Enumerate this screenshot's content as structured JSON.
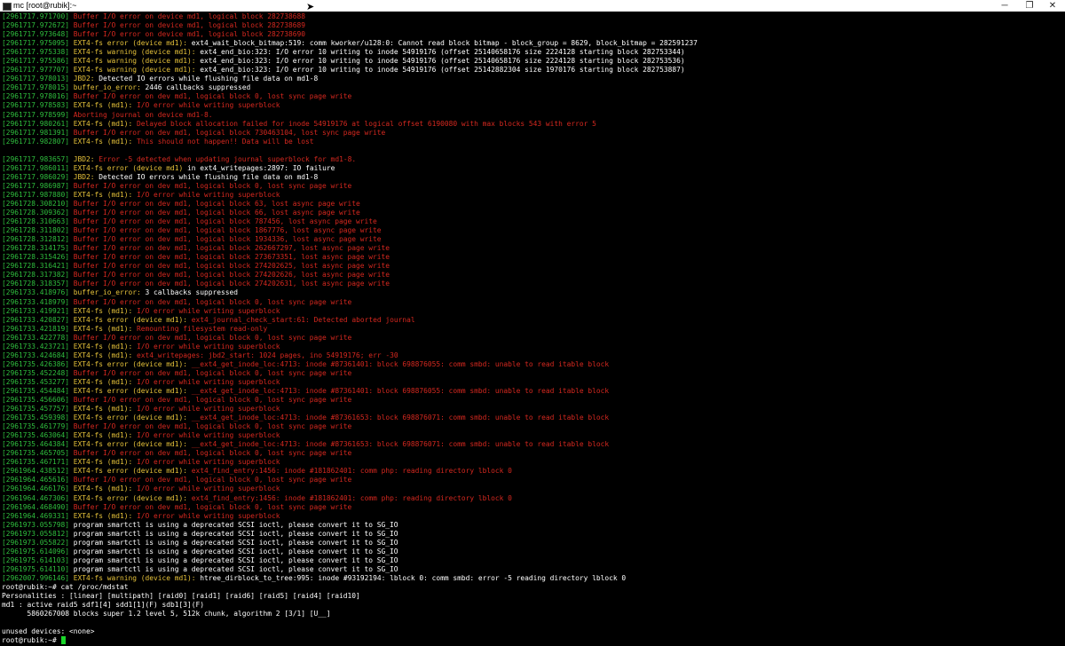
{
  "window": {
    "title": "mc [root@rubik]:~",
    "minimize_glyph": "─",
    "restore_glyph": "❐",
    "close_glyph": "✕"
  },
  "terminal": {
    "lines": [
      {
        "ts": "[2961717.971700]",
        "segs": [
          {
            "c": "red",
            "t": " Buffer I/O error on device md1, logical block 282738688"
          }
        ]
      },
      {
        "ts": "[2961717.972672]",
        "segs": [
          {
            "c": "red",
            "t": " Buffer I/O error on device md1, logical block 282738689"
          }
        ]
      },
      {
        "ts": "[2961717.973648]",
        "segs": [
          {
            "c": "red",
            "t": " Buffer I/O error on device md1, logical block 282738690"
          }
        ]
      },
      {
        "ts": "[2961717.975095]",
        "segs": [
          {
            "c": "yellow",
            "t": " EXT4-fs error (device md1): "
          },
          {
            "c": "white",
            "t": "ext4_wait_block_bitmap:519: comm kworker/u128:0: Cannot read block bitmap - block_group = 8629, block_bitmap = 282591237"
          }
        ]
      },
      {
        "ts": "[2961717.975338]",
        "segs": [
          {
            "c": "yellow",
            "t": " EXT4-fs warning (device md1): "
          },
          {
            "c": "white",
            "t": "ext4_end_bio:323: I/O error 10 writing to inode 54919176 (offset 25140658176 size 2224128 starting block 282753344)"
          }
        ]
      },
      {
        "ts": "[2961717.975586]",
        "segs": [
          {
            "c": "yellow",
            "t": " EXT4-fs warning (device md1): "
          },
          {
            "c": "white",
            "t": "ext4_end_bio:323: I/O error 10 writing to inode 54919176 (offset 25140658176 size 2224128 starting block 282753536)"
          }
        ]
      },
      {
        "ts": "[2961717.977707]",
        "segs": [
          {
            "c": "yellow",
            "t": " EXT4-fs warning (device md1): "
          },
          {
            "c": "white",
            "t": "ext4_end_bio:323: I/O error 10 writing to inode 54919176 (offset 25142882304 size 1970176 starting block 282753887)"
          }
        ]
      },
      {
        "ts": "[2961717.978013]",
        "segs": [
          {
            "c": "yellow",
            "t": " JBD2: "
          },
          {
            "c": "white",
            "t": "Detected IO errors while flushing file data on md1-8"
          }
        ]
      },
      {
        "ts": "[2961717.978015]",
        "segs": [
          {
            "c": "yellow",
            "t": " buffer_io_error: "
          },
          {
            "c": "white",
            "t": "2446 callbacks suppressed"
          }
        ]
      },
      {
        "ts": "[2961717.978016]",
        "segs": [
          {
            "c": "red",
            "t": " Buffer I/O error on dev md1, logical block 0, lost sync page write"
          }
        ]
      },
      {
        "ts": "[2961717.978583]",
        "segs": [
          {
            "c": "yellow",
            "t": " EXT4-fs (md1): "
          },
          {
            "c": "red",
            "t": "I/O error while writing superblock"
          }
        ]
      },
      {
        "ts": "[2961717.978599]",
        "segs": [
          {
            "c": "red",
            "t": " Aborting journal on device md1-8."
          }
        ]
      },
      {
        "ts": "[2961717.980261]",
        "segs": [
          {
            "c": "yellow",
            "t": " EXT4-fs (md1): "
          },
          {
            "c": "red",
            "t": "Delayed block allocation failed for inode 54919176 at logical offset 6190080 with max blocks 543 with error 5"
          }
        ]
      },
      {
        "ts": "[2961717.981391]",
        "segs": [
          {
            "c": "red",
            "t": " Buffer I/O error on dev md1, logical block 730463104, lost sync page write"
          }
        ]
      },
      {
        "ts": "[2961717.982807]",
        "segs": [
          {
            "c": "yellow",
            "t": " EXT4-fs (md1): "
          },
          {
            "c": "red",
            "t": "This should not happen!! Data will be lost"
          }
        ]
      },
      {
        "ts": "",
        "segs": []
      },
      {
        "ts": "[2961717.983657]",
        "segs": [
          {
            "c": "yellow",
            "t": " JBD2: "
          },
          {
            "c": "red",
            "t": "Error -5 detected when updating journal superblock for md1-8."
          }
        ]
      },
      {
        "ts": "[2961717.986011]",
        "segs": [
          {
            "c": "yellow",
            "t": " EXT4-fs error (device md1) "
          },
          {
            "c": "white",
            "t": "in ext4_writepages:2897: IO failure"
          }
        ]
      },
      {
        "ts": "[2961717.986029]",
        "segs": [
          {
            "c": "yellow",
            "t": " JBD2: "
          },
          {
            "c": "white",
            "t": "Detected IO errors while flushing file data on md1-8"
          }
        ]
      },
      {
        "ts": "[2961717.986987]",
        "segs": [
          {
            "c": "red",
            "t": " Buffer I/O error on dev md1, logical block 0, lost sync page write"
          }
        ]
      },
      {
        "ts": "[2961717.987880]",
        "segs": [
          {
            "c": "yellow",
            "t": " EXT4-fs (md1): "
          },
          {
            "c": "red",
            "t": "I/O error while writing superblock"
          }
        ]
      },
      {
        "ts": "[2961728.308210]",
        "segs": [
          {
            "c": "red",
            "t": " Buffer I/O error on dev md1, logical block 63, lost async page write"
          }
        ]
      },
      {
        "ts": "[2961728.309362]",
        "segs": [
          {
            "c": "red",
            "t": " Buffer I/O error on dev md1, logical block 66, lost async page write"
          }
        ]
      },
      {
        "ts": "[2961728.310663]",
        "segs": [
          {
            "c": "red",
            "t": " Buffer I/O error on dev md1, logical block 787456, lost async page write"
          }
        ]
      },
      {
        "ts": "[2961728.311802]",
        "segs": [
          {
            "c": "red",
            "t": " Buffer I/O error on dev md1, logical block 1867776, lost async page write"
          }
        ]
      },
      {
        "ts": "[2961728.312812]",
        "segs": [
          {
            "c": "red",
            "t": " Buffer I/O error on dev md1, logical block 1934336, lost async page write"
          }
        ]
      },
      {
        "ts": "[2961728.314175]",
        "segs": [
          {
            "c": "red",
            "t": " Buffer I/O error on dev md1, logical block 262667297, lost async page write"
          }
        ]
      },
      {
        "ts": "[2961728.315426]",
        "segs": [
          {
            "c": "red",
            "t": " Buffer I/O error on dev md1, logical block 273673351, lost async page write"
          }
        ]
      },
      {
        "ts": "[2961728.316421]",
        "segs": [
          {
            "c": "red",
            "t": " Buffer I/O error on dev md1, logical block 274202625, lost async page write"
          }
        ]
      },
      {
        "ts": "[2961728.317382]",
        "segs": [
          {
            "c": "red",
            "t": " Buffer I/O error on dev md1, logical block 274202626, lost async page write"
          }
        ]
      },
      {
        "ts": "[2961728.318357]",
        "segs": [
          {
            "c": "red",
            "t": " Buffer I/O error on dev md1, logical block 274202631, lost async page write"
          }
        ]
      },
      {
        "ts": "[2961733.418976]",
        "segs": [
          {
            "c": "yellow",
            "t": " buffer_io_error: "
          },
          {
            "c": "white",
            "t": "3 callbacks suppressed"
          }
        ]
      },
      {
        "ts": "[2961733.418979]",
        "segs": [
          {
            "c": "red",
            "t": " Buffer I/O error on dev md1, logical block 0, lost sync page write"
          }
        ]
      },
      {
        "ts": "[2961733.419921]",
        "segs": [
          {
            "c": "yellow",
            "t": " EXT4-fs (md1): "
          },
          {
            "c": "red",
            "t": "I/O error while writing superblock"
          }
        ]
      },
      {
        "ts": "[2961733.420827]",
        "segs": [
          {
            "c": "yellow",
            "t": " EXT4-fs error (device md1): "
          },
          {
            "c": "red",
            "t": "ext4_journal_check_start:61: Detected aborted journal"
          }
        ]
      },
      {
        "ts": "[2961733.421819]",
        "segs": [
          {
            "c": "yellow",
            "t": " EXT4-fs (md1): "
          },
          {
            "c": "red",
            "t": "Remounting filesystem read-only"
          }
        ]
      },
      {
        "ts": "[2961733.422778]",
        "segs": [
          {
            "c": "red",
            "t": " Buffer I/O error on dev md1, logical block 0, lost sync page write"
          }
        ]
      },
      {
        "ts": "[2961733.423721]",
        "segs": [
          {
            "c": "yellow",
            "t": " EXT4-fs (md1): "
          },
          {
            "c": "red",
            "t": "I/O error while writing superblock"
          }
        ]
      },
      {
        "ts": "[2961733.424684]",
        "segs": [
          {
            "c": "yellow",
            "t": " EXT4-fs (md1): "
          },
          {
            "c": "red",
            "t": "ext4_writepages: jbd2_start: 1024 pages, ino 54919176; err -30"
          }
        ]
      },
      {
        "ts": "[2961735.426386]",
        "segs": [
          {
            "c": "yellow",
            "t": " EXT4-fs error (device md1): "
          },
          {
            "c": "red",
            "t": "__ext4_get_inode_loc:4713: inode #87361401: block 698876055: comm smbd: unable to read itable block"
          }
        ]
      },
      {
        "ts": "[2961735.452248]",
        "segs": [
          {
            "c": "red",
            "t": " Buffer I/O error on dev md1, logical block 0, lost sync page write"
          }
        ]
      },
      {
        "ts": "[2961735.453277]",
        "segs": [
          {
            "c": "yellow",
            "t": " EXT4-fs (md1): "
          },
          {
            "c": "red",
            "t": "I/O error while writing superblock"
          }
        ]
      },
      {
        "ts": "[2961735.454484]",
        "segs": [
          {
            "c": "yellow",
            "t": " EXT4-fs error (device md1): "
          },
          {
            "c": "red",
            "t": "__ext4_get_inode_loc:4713: inode #87361401: block 698876055: comm smbd: unable to read itable block"
          }
        ]
      },
      {
        "ts": "[2961735.456606]",
        "segs": [
          {
            "c": "red",
            "t": " Buffer I/O error on dev md1, logical block 0, lost sync page write"
          }
        ]
      },
      {
        "ts": "[2961735.457757]",
        "segs": [
          {
            "c": "yellow",
            "t": " EXT4-fs (md1): "
          },
          {
            "c": "red",
            "t": "I/O error while writing superblock"
          }
        ]
      },
      {
        "ts": "[2961735.459398]",
        "segs": [
          {
            "c": "yellow",
            "t": " EXT4-fs error (device md1): "
          },
          {
            "c": "red",
            "t": "__ext4_get_inode_loc:4713: inode #87361653: block 698876071: comm smbd: unable to read itable block"
          }
        ]
      },
      {
        "ts": "[2961735.461779]",
        "segs": [
          {
            "c": "red",
            "t": " Buffer I/O error on dev md1, logical block 0, lost sync page write"
          }
        ]
      },
      {
        "ts": "[2961735.463064]",
        "segs": [
          {
            "c": "yellow",
            "t": " EXT4-fs (md1): "
          },
          {
            "c": "red",
            "t": "I/O error while writing superblock"
          }
        ]
      },
      {
        "ts": "[2961735.464384]",
        "segs": [
          {
            "c": "yellow",
            "t": " EXT4-fs error (device md1): "
          },
          {
            "c": "red",
            "t": "__ext4_get_inode_loc:4713: inode #87361653: block 698876071: comm smbd: unable to read itable block"
          }
        ]
      },
      {
        "ts": "[2961735.465705]",
        "segs": [
          {
            "c": "red",
            "t": " Buffer I/O error on dev md1, logical block 0, lost sync page write"
          }
        ]
      },
      {
        "ts": "[2961735.467171]",
        "segs": [
          {
            "c": "yellow",
            "t": " EXT4-fs (md1): "
          },
          {
            "c": "red",
            "t": "I/O error while writing superblock"
          }
        ]
      },
      {
        "ts": "[2961964.438512]",
        "segs": [
          {
            "c": "yellow",
            "t": " EXT4-fs error (device md1): "
          },
          {
            "c": "red",
            "t": "ext4_find_entry:1456: inode #181862401: comm php: reading directory lblock 0"
          }
        ]
      },
      {
        "ts": "[2961964.465616]",
        "segs": [
          {
            "c": "red",
            "t": " Buffer I/O error on dev md1, logical block 0, lost sync page write"
          }
        ]
      },
      {
        "ts": "[2961964.466176]",
        "segs": [
          {
            "c": "yellow",
            "t": " EXT4-fs (md1): "
          },
          {
            "c": "red",
            "t": "I/O error while writing superblock"
          }
        ]
      },
      {
        "ts": "[2961964.467306]",
        "segs": [
          {
            "c": "yellow",
            "t": " EXT4-fs error (device md1): "
          },
          {
            "c": "red",
            "t": "ext4_find_entry:1456: inode #181862401: comm php: reading directory lblock 0"
          }
        ]
      },
      {
        "ts": "[2961964.468490]",
        "segs": [
          {
            "c": "red",
            "t": " Buffer I/O error on dev md1, logical block 0, lost sync page write"
          }
        ]
      },
      {
        "ts": "[2961964.469331]",
        "segs": [
          {
            "c": "yellow",
            "t": " EXT4-fs (md1): "
          },
          {
            "c": "red",
            "t": "I/O error while writing superblock"
          }
        ]
      },
      {
        "ts": "[2961973.055798]",
        "segs": [
          {
            "c": "white",
            "t": " program smartctl is using a deprecated SCSI ioctl, please convert it to SG_IO"
          }
        ]
      },
      {
        "ts": "[2961973.055812]",
        "segs": [
          {
            "c": "white",
            "t": " program smartctl is using a deprecated SCSI ioctl, please convert it to SG_IO"
          }
        ]
      },
      {
        "ts": "[2961973.055822]",
        "segs": [
          {
            "c": "white",
            "t": " program smartctl is using a deprecated SCSI ioctl, please convert it to SG_IO"
          }
        ]
      },
      {
        "ts": "[2961975.614096]",
        "segs": [
          {
            "c": "white",
            "t": " program smartctl is using a deprecated SCSI ioctl, please convert it to SG_IO"
          }
        ]
      },
      {
        "ts": "[2961975.614103]",
        "segs": [
          {
            "c": "white",
            "t": " program smartctl is using a deprecated SCSI ioctl, please convert it to SG_IO"
          }
        ]
      },
      {
        "ts": "[2961975.614110]",
        "segs": [
          {
            "c": "white",
            "t": " program smartctl is using a deprecated SCSI ioctl, please convert it to SG_IO"
          }
        ]
      },
      {
        "ts": "[2962007.996146]",
        "segs": [
          {
            "c": "yellow",
            "t": " EXT4-fs warning (device md1): "
          },
          {
            "c": "white",
            "t": "htree_dirblock_to_tree:995: inode #93192194: lblock 0: comm smbd: error -5 reading directory lblock 0"
          }
        ]
      },
      {
        "ts": "",
        "segs": [
          {
            "c": "white",
            "t": "root@rubik:~# cat /proc/mdstat"
          }
        ]
      },
      {
        "ts": "",
        "segs": [
          {
            "c": "white",
            "t": "Personalities : [linear] [multipath] [raid0] [raid1] [raid6] [raid5] [raid4] [raid10]"
          }
        ]
      },
      {
        "ts": "",
        "segs": [
          {
            "c": "white",
            "t": "md1 : active raid5 sdf1[4] sdd1[1](F) sdb1[3](F)"
          }
        ]
      },
      {
        "ts": "",
        "segs": [
          {
            "c": "white",
            "t": "      5860267008 blocks super 1.2 level 5, 512k chunk, algorithm 2 [3/1] [U__]"
          }
        ]
      },
      {
        "ts": "",
        "segs": []
      },
      {
        "ts": "",
        "segs": [
          {
            "c": "white",
            "t": "unused devices: <none>"
          }
        ]
      }
    ],
    "prompt": "root@rubik:~# "
  },
  "colors": {
    "background": "#000000",
    "timestamp": "#2fbf3e",
    "error_red": "#d5281f",
    "label_yellow": "#e6c23a",
    "text_white": "#ffffff",
    "cursor_green": "#1ad62a"
  }
}
